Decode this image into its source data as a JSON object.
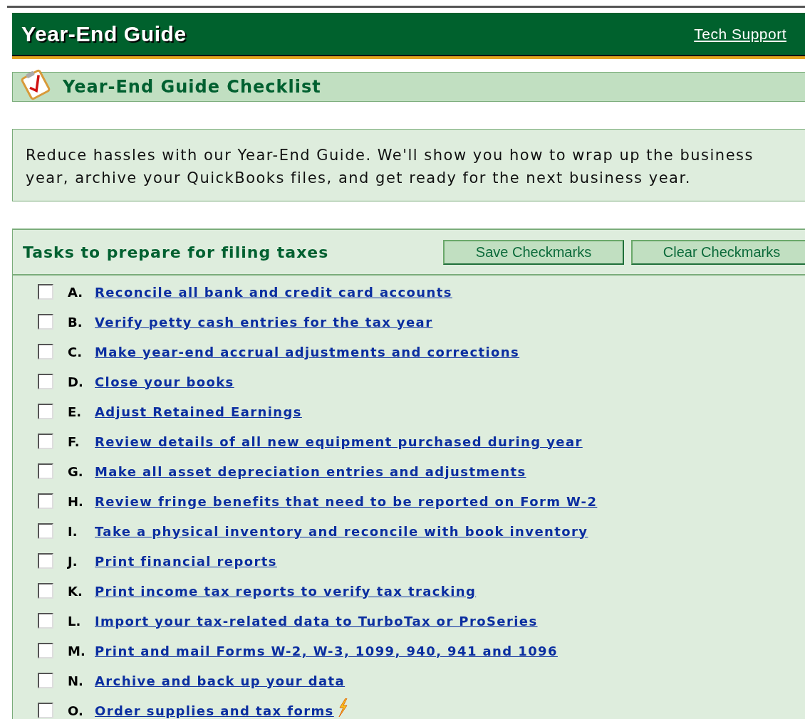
{
  "header": {
    "title": "Year-End Guide",
    "link": "Tech Support"
  },
  "checklist_bar": {
    "title": "Year-End Guide Checklist"
  },
  "intro": "Reduce hassles with our Year-End Guide. We'll show you how to wrap up the business year, archive your QuickBooks files, and get ready for the next business year.",
  "tasks": {
    "title": "Tasks to prepare for filing taxes",
    "buttons": [
      "Save Checkmarks",
      "Clear Checkmarks"
    ],
    "items": [
      {
        "letter": "A.",
        "label": "Reconcile all bank and credit card accounts",
        "checked": false,
        "featured": false
      },
      {
        "letter": "B.",
        "label": "Verify petty cash entries for the tax year",
        "checked": false,
        "featured": false
      },
      {
        "letter": "C.",
        "label": "Make year-end accrual adjustments and corrections",
        "checked": false,
        "featured": false
      },
      {
        "letter": "D.",
        "label": "Close your books",
        "checked": false,
        "featured": false
      },
      {
        "letter": "E.",
        "label": "Adjust Retained Earnings",
        "checked": false,
        "featured": false
      },
      {
        "letter": "F.",
        "label": "Review details of all new equipment purchased during year",
        "checked": false,
        "featured": false
      },
      {
        "letter": "G.",
        "label": "Make all asset depreciation entries and adjustments",
        "checked": false,
        "featured": false
      },
      {
        "letter": "H.",
        "label": "Review fringe benefits that need to be reported on Form W-2",
        "checked": false,
        "featured": false
      },
      {
        "letter": "I.",
        "label": "Take a physical inventory and reconcile with book inventory",
        "checked": false,
        "featured": false
      },
      {
        "letter": "J.",
        "label": "Print financial reports",
        "checked": false,
        "featured": false
      },
      {
        "letter": "K.",
        "label": "Print income tax reports to verify tax tracking",
        "checked": false,
        "featured": false
      },
      {
        "letter": "L.",
        "label": "Import your tax-related data to TurboTax or ProSeries",
        "checked": false,
        "featured": false
      },
      {
        "letter": "M.",
        "label": "Print and mail Forms W-2, W-3, 1099, 940, 941 and 1096",
        "checked": false,
        "featured": false
      },
      {
        "letter": "N.",
        "label": "Archive and back up your data",
        "checked": false,
        "featured": false
      },
      {
        "letter": "O.",
        "label": "Order supplies and tax forms",
        "checked": false,
        "featured": true
      }
    ]
  }
}
